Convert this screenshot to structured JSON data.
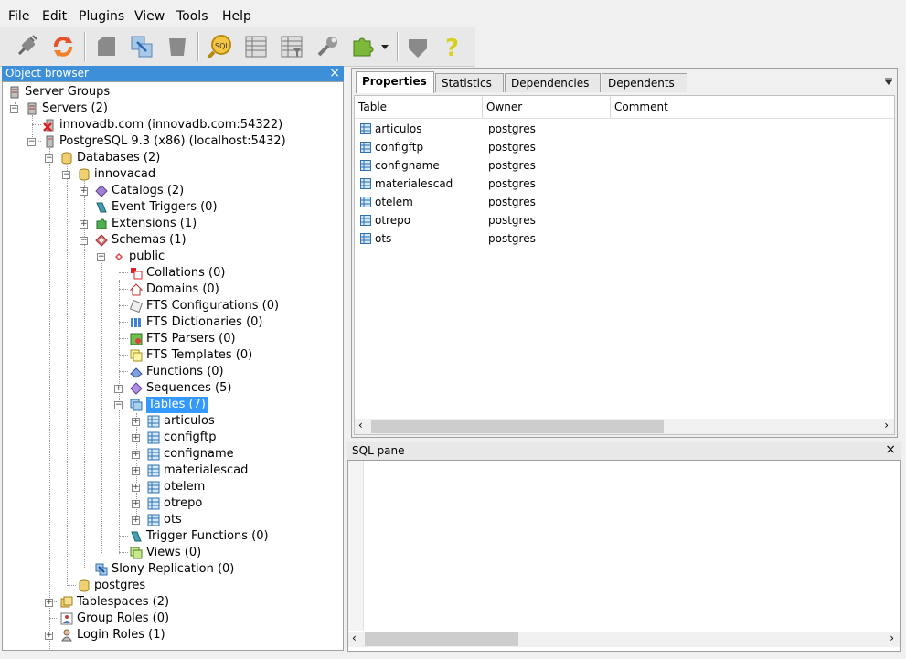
{
  "menu": [
    "File",
    "Edit",
    "Plugins",
    "View",
    "Tools",
    "Help"
  ],
  "toolbar": {
    "icons": [
      "connect-icon",
      "refresh-icon",
      "drop-icon",
      "properties-icon",
      "create-icon",
      "sql-query-icon",
      "view-data-icon",
      "filtered-data-icon",
      "maintenance-icon",
      "plugins-icon",
      "dropdown-icon",
      "hint-icon",
      "help-icon"
    ]
  },
  "object_browser": {
    "title": "Object browser",
    "close": "×",
    "tree": [
      {
        "label": "Server Groups"
      },
      {
        "label": "Servers (2)"
      },
      {
        "label": "innovadb.com (innovadb.com:54322)"
      },
      {
        "label": "PostgreSQL 9.3 (x86) (localhost:5432)"
      },
      {
        "label": "Databases (2)"
      },
      {
        "label": "innovacad"
      },
      {
        "label": "Catalogs (2)"
      },
      {
        "label": "Event Triggers (0)"
      },
      {
        "label": "Extensions (1)"
      },
      {
        "label": "Schemas (1)"
      },
      {
        "label": "public"
      },
      {
        "label": "Collations (0)"
      },
      {
        "label": "Domains (0)"
      },
      {
        "label": "FTS Configurations (0)"
      },
      {
        "label": "FTS Dictionaries (0)"
      },
      {
        "label": "FTS Parsers (0)"
      },
      {
        "label": "FTS Templates (0)"
      },
      {
        "label": "Functions (0)"
      },
      {
        "label": "Sequences (5)"
      },
      {
        "label": "Tables (7)"
      },
      {
        "label": "articulos"
      },
      {
        "label": "configftp"
      },
      {
        "label": "configname"
      },
      {
        "label": "materialescad"
      },
      {
        "label": "otelem"
      },
      {
        "label": "otrepo"
      },
      {
        "label": "ots"
      },
      {
        "label": "Trigger Functions (0)"
      },
      {
        "label": "Views (0)"
      },
      {
        "label": "Slony Replication (0)"
      },
      {
        "label": "postgres"
      },
      {
        "label": "Tablespaces (2)"
      },
      {
        "label": "Group Roles (0)"
      },
      {
        "label": "Login Roles (1)"
      }
    ]
  },
  "properties": {
    "tabs": [
      "Properties",
      "Statistics",
      "Dependencies",
      "Dependents"
    ],
    "active_tab": "Properties",
    "columns": [
      "Table",
      "Owner",
      "Comment"
    ],
    "rows": [
      {
        "table": "articulos",
        "owner": "postgres",
        "comment": ""
      },
      {
        "table": "configftp",
        "owner": "postgres",
        "comment": ""
      },
      {
        "table": "configname",
        "owner": "postgres",
        "comment": ""
      },
      {
        "table": "materialescad",
        "owner": "postgres",
        "comment": ""
      },
      {
        "table": "otelem",
        "owner": "postgres",
        "comment": ""
      },
      {
        "table": "otrepo",
        "owner": "postgres",
        "comment": ""
      },
      {
        "table": "ots",
        "owner": "postgres",
        "comment": ""
      }
    ]
  },
  "sql_pane": {
    "title": "SQL pane",
    "close": "×",
    "content": ""
  },
  "colors": {
    "selection": "#3399ff",
    "panel_header": "#3d8fd9"
  }
}
